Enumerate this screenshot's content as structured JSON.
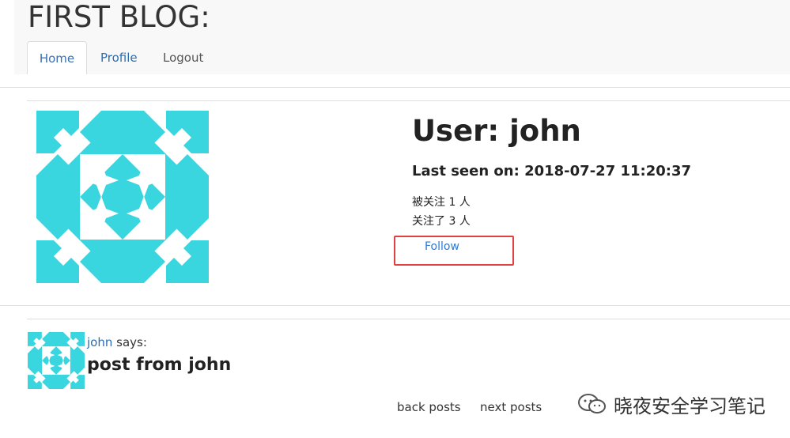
{
  "header": {
    "title": "FIRST BLOG:",
    "nav": {
      "home": "Home",
      "profile": "Profile",
      "logout": "Logout"
    }
  },
  "profile": {
    "heading": "User: john",
    "last_seen_label": "Last seen on:",
    "last_seen_value": "2018-07-27 11:20:37",
    "followers_text": "被关注 1 人",
    "following_text": "关注了 3 人",
    "follow_label": "Follow",
    "avatar_icon": "identicon-avatar",
    "avatar_color": "#3ad6df",
    "highlight_color": "#e04040"
  },
  "posts": [
    {
      "author": "john",
      "says": "says:",
      "body": "post from john"
    }
  ],
  "pagination": {
    "back": "back posts",
    "next": "next posts"
  },
  "watermark": {
    "text": "晓夜安全学习笔记",
    "icon": "wechat-icon"
  },
  "colors": {
    "link": "#2a6db0",
    "follow_link": "#2a7ad8"
  }
}
